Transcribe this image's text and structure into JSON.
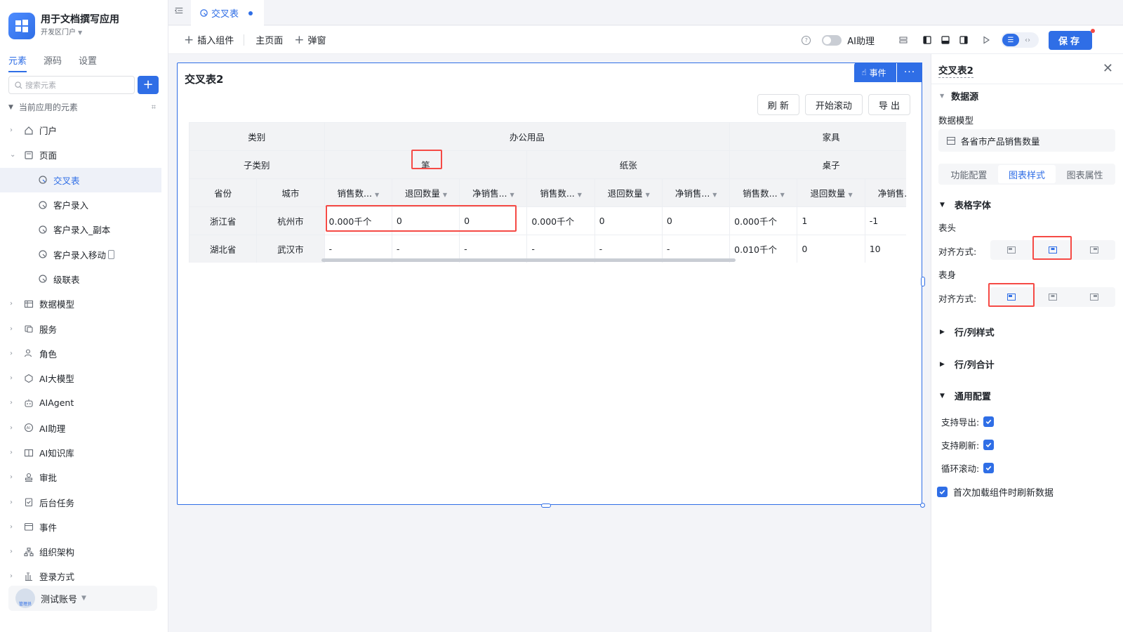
{
  "app": {
    "title": "用于文档撰写应用",
    "portal": "开发区门户"
  },
  "sidebar": {
    "tabs": [
      {
        "label": "元素"
      },
      {
        "label": "源码"
      },
      {
        "label": "设置"
      }
    ],
    "search_placeholder": "搜索元素",
    "section": "当前应用的元素",
    "tree": [
      {
        "label": "门户",
        "icon": "home-icon"
      },
      {
        "label": "页面",
        "icon": "page-icon",
        "expanded": true
      },
      {
        "label": "交叉表",
        "icon": "report-icon",
        "child": true,
        "active": true
      },
      {
        "label": "客户录入",
        "icon": "report-icon",
        "child": true
      },
      {
        "label": "客户录入_副本",
        "icon": "report-icon",
        "child": true
      },
      {
        "label": "客户录入移动",
        "icon": "report-icon",
        "child": true,
        "mobile": true
      },
      {
        "label": "级联表",
        "icon": "report-icon",
        "child": true
      },
      {
        "label": "数据模型",
        "icon": "table-icon"
      },
      {
        "label": "服务",
        "icon": "service-icon"
      },
      {
        "label": "角色",
        "icon": "role-icon"
      },
      {
        "label": "AI大模型",
        "icon": "ai-model-icon"
      },
      {
        "label": "AIAgent",
        "icon": "robot-icon"
      },
      {
        "label": "AI助理",
        "icon": "ai-assistant-icon"
      },
      {
        "label": "AI知识库",
        "icon": "book-icon"
      },
      {
        "label": "审批",
        "icon": "stamp-icon"
      },
      {
        "label": "后台任务",
        "icon": "task-icon"
      },
      {
        "label": "事件",
        "icon": "event-icon"
      },
      {
        "label": "组织架构",
        "icon": "org-icon"
      },
      {
        "label": "登录方式",
        "icon": "login-icon"
      }
    ],
    "account": {
      "name": "测试账号",
      "role_badge": "管理员"
    }
  },
  "top_tab": {
    "label": "交叉表"
  },
  "toolbar": {
    "insert": "插入组件",
    "home": "主页面",
    "popup": "弹窗",
    "ai_label": "AI助理",
    "save": "保存"
  },
  "widget": {
    "title": "交叉表2",
    "event_btn": "事件",
    "more_btn": "···",
    "refresh": "刷 新",
    "scroll": "开始滚动",
    "export": "导 出"
  },
  "grid": {
    "h_category": "类别",
    "h_subcategory": "子类别",
    "h_province": "省份",
    "h_city": "城市",
    "cat1": "办公用品",
    "cat2": "家具",
    "sub1": "笔",
    "sub2": "纸张",
    "sub3": "桌子",
    "m1": "销售数...",
    "m2": "退回数量",
    "m3": "净销售...",
    "m3b": "净销售..",
    "rows": [
      {
        "province": "浙江省",
        "city": "杭州市",
        "values": [
          "0.000千个",
          "0",
          "0",
          "0.000千个",
          "0",
          "0",
          "0.000千个",
          "1",
          "-1"
        ]
      },
      {
        "province": "湖北省",
        "city": "武汉市",
        "values": [
          "-",
          "-",
          "-",
          "-",
          "-",
          "-",
          "0.010千个",
          "0",
          "10"
        ]
      }
    ]
  },
  "panel": {
    "title": "交叉表2",
    "datasource": "数据源",
    "model_label": "数据模型",
    "model_value": "各省市产品销售数量",
    "tabs": [
      {
        "label": "功能配置"
      },
      {
        "label": "图表样式",
        "active": true
      },
      {
        "label": "图表属性"
      }
    ],
    "font_section": "表格字体",
    "header_label": "表头",
    "body_label": "表身",
    "align_label": "对齐方式:",
    "header_align": "center",
    "body_align": "left",
    "row_col_style": "行/列样式",
    "row_col_total": "行/列合计",
    "general": "通用配置",
    "support_export": "支持导出:",
    "support_refresh": "支持刷新:",
    "loop_scroll": "循环滚动:",
    "first_load": "首次加载组件时刷新数据"
  },
  "colors": {
    "accent": "#2f6ee6",
    "highlight": "#f54a45"
  }
}
